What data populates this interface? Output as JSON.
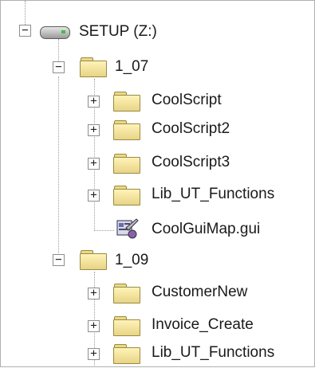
{
  "tree": {
    "root": {
      "label": "SETUP (Z:)",
      "expander": "−",
      "icon": "drive-icon"
    },
    "groups": [
      {
        "label": "1_07",
        "expander": "−",
        "icon": "folder-icon",
        "children": [
          {
            "label": "CoolScript",
            "expander": "+",
            "icon": "folder-icon"
          },
          {
            "label": "CoolScript2",
            "expander": "+",
            "icon": "folder-icon"
          },
          {
            "label": "CoolScript3",
            "expander": "+",
            "icon": "folder-icon"
          },
          {
            "label": "Lib_UT_Functions",
            "expander": "+",
            "icon": "folder-icon"
          },
          {
            "label": "CoolGuiMap.gui",
            "expander": "",
            "icon": "gui-map-file-icon"
          }
        ]
      },
      {
        "label": "1_09",
        "expander": "−",
        "icon": "folder-icon",
        "children": [
          {
            "label": "CustomerNew",
            "expander": "+",
            "icon": "folder-icon"
          },
          {
            "label": "Invoice_Create",
            "expander": "+",
            "icon": "folder-icon"
          },
          {
            "label": "Lib_UT_Functions",
            "expander": "+",
            "icon": "folder-icon"
          }
        ]
      }
    ]
  }
}
